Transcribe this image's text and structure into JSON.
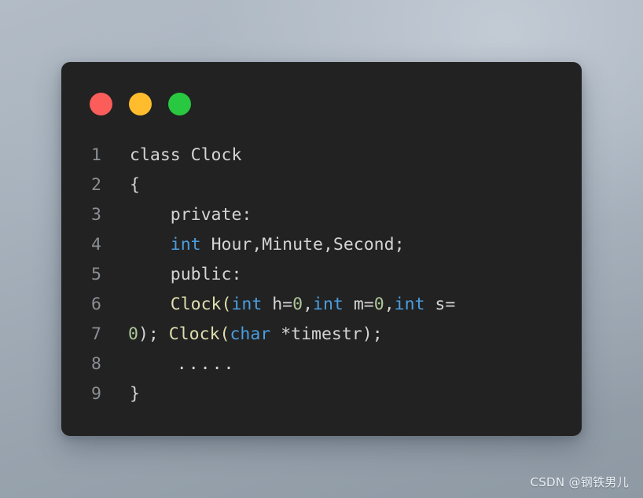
{
  "window": {
    "background_gradient_from": "#b3bcc6",
    "background_gradient_to": "#8e99a4",
    "card_background": "#222222",
    "controls": [
      {
        "name": "close",
        "label": "",
        "color": "#fb5d5a"
      },
      {
        "name": "minimize",
        "label": "",
        "color": "#ffbd2e"
      },
      {
        "name": "maximize",
        "label": "",
        "color": "#28c840"
      }
    ]
  },
  "code": {
    "language": "cpp",
    "default_text_color": "#d4d4d4",
    "line_number_color": "#8b8f93",
    "keyword_color": "#4a9ddf",
    "function_color": "#dfdfaf",
    "number_color": "#adc79a",
    "lines": [
      {
        "number": "1",
        "text": "class Clock"
      },
      {
        "number": "2",
        "text": "{"
      },
      {
        "number": "3",
        "text": "    private:"
      },
      {
        "number": "4",
        "text": "    int Hour,Minute,Second;"
      },
      {
        "number": "5",
        "text": "    public:"
      },
      {
        "number": "6",
        "text": "    Clock(int h=0,int m=0,int s="
      },
      {
        "number": "7",
        "text": "0); Clock(char *timestr);"
      },
      {
        "number": "8",
        "text": "    ....."
      },
      {
        "number": "9",
        "text": "}"
      }
    ],
    "tokens": {
      "l1_a": "class Clock",
      "l2_a": "{",
      "l3_a": "    private:",
      "l4_a": "    ",
      "l4_b": "int",
      "l4_c": " Hour,Minute,Second;",
      "l5_a": "    public:",
      "l6_a": "    ",
      "l6_b": "Clock(",
      "l6_c": "int",
      "l6_d": " h=",
      "l6_e": "0",
      "l6_f": ",",
      "l6_g": "int",
      "l6_h": " m=",
      "l6_i": "0",
      "l6_j": ",",
      "l6_k": "int",
      "l6_l": " s=",
      "l7_a": "0",
      "l7_b": "); ",
      "l7_c": "Clock(",
      "l7_d": "char",
      "l7_e": " *timestr);",
      "l8_a": "    .....",
      "l9_a": "}"
    }
  },
  "watermark": {
    "text": "CSDN @钢铁男儿"
  }
}
